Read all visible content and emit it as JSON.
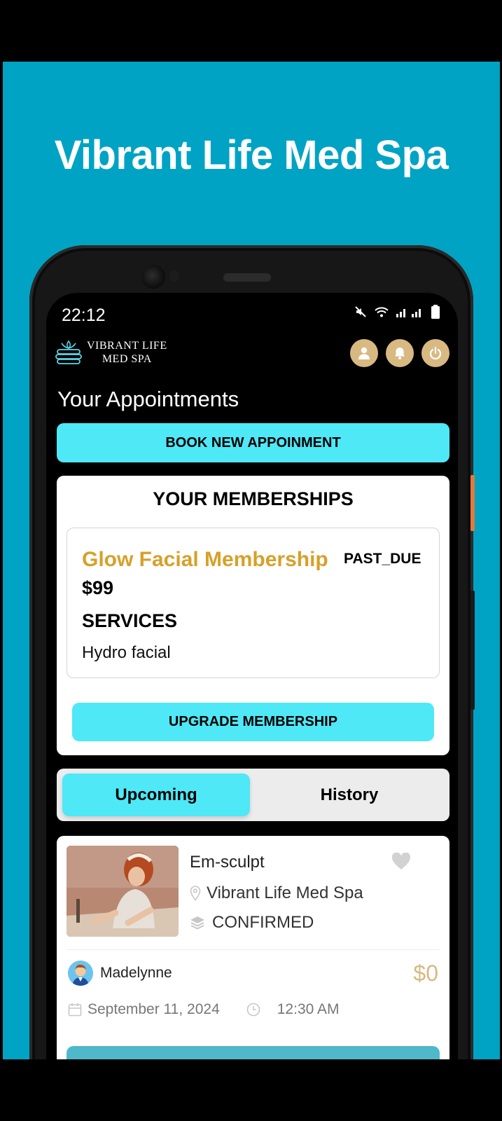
{
  "banner": {
    "title": "Vibrant Life Med Spa"
  },
  "status_bar": {
    "time": "22:12"
  },
  "brand": {
    "line1": "VIBRANT LIFE",
    "line2": "MED SPA"
  },
  "header_icons": [
    "user-icon",
    "bell-icon",
    "power-icon"
  ],
  "page": {
    "title": "Your Appointments"
  },
  "actions": {
    "book_label": "BOOK NEW APPOINMENT"
  },
  "memberships": {
    "heading": "YOUR MEMBERSHIPS",
    "items": [
      {
        "name": "Glow Facial Membership",
        "status": "PAST_DUE",
        "price": "$99",
        "services_heading": "SERVICES",
        "services": [
          "Hydro facial"
        ]
      }
    ],
    "upgrade_label": "UPGRADE MEMBERSHIP"
  },
  "tabs": [
    {
      "label": "Upcoming",
      "active": true
    },
    {
      "label": "History",
      "active": false
    }
  ],
  "appointments": [
    {
      "service": "Em-sculpt",
      "location": "Vibrant Life Med Spa",
      "status": "CONFIRMED",
      "provider": "Madelynne",
      "price": "$0",
      "date": "September 11, 2024",
      "time": "12:30 AM"
    }
  ],
  "colors": {
    "background": "#00a3c4",
    "accent": "#4fe8f7",
    "gold": "#d8b982",
    "membership_name": "#d6a12a"
  }
}
